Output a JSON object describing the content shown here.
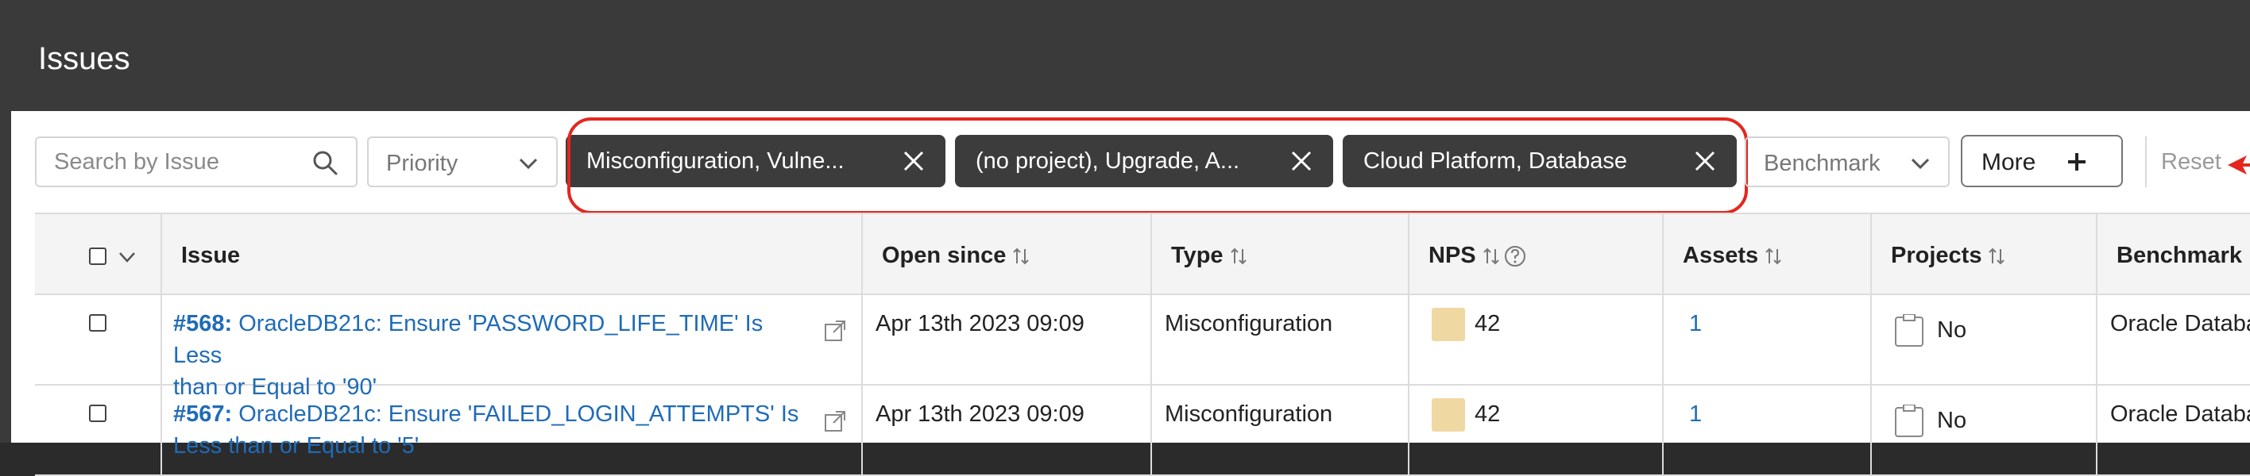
{
  "header": {
    "title": "Issues"
  },
  "filters": {
    "search_placeholder": "Search by Issue",
    "priority_label": "Priority",
    "chips": [
      {
        "label": "Misconfiguration, Vulne..."
      },
      {
        "label": "(no project), Upgrade, A..."
      },
      {
        "label": "Cloud Platform, Database"
      }
    ],
    "benchmark_label": "Benchmark",
    "more_label": "More",
    "reset_label": "Reset"
  },
  "table": {
    "columns": {
      "issue": "Issue",
      "open_since": "Open since",
      "type": "Type",
      "nps": "NPS",
      "assets": "Assets",
      "projects": "Projects",
      "benchmark": "Benchmark"
    },
    "rows": [
      {
        "id": "#568:",
        "title_line1": "OracleDB21c: Ensure 'PASSWORD_LIFE_TIME' Is Less",
        "title_line2": "than or Equal to '90'",
        "open_since": "Apr 13th 2023 09:09",
        "type": "Misconfiguration",
        "nps": "42",
        "assets": "1",
        "projects": "No",
        "benchmark": "Oracle Databa"
      },
      {
        "id": "#567:",
        "title_line1": "OracleDB21c: Ensure 'FAILED_LOGIN_ATTEMPTS' Is",
        "title_line2": "Less than or Equal to '5'",
        "open_since": "Apr 13th 2023 09:09",
        "type": "Misconfiguration",
        "nps": "42",
        "assets": "1",
        "projects": "No",
        "benchmark": "Oracle Databa"
      }
    ]
  },
  "colors": {
    "accent_link": "#1f6bb8",
    "highlight": "#e4261f",
    "chip_bg": "#3c3c3c",
    "nps_swatch": "#f0d8a2"
  }
}
